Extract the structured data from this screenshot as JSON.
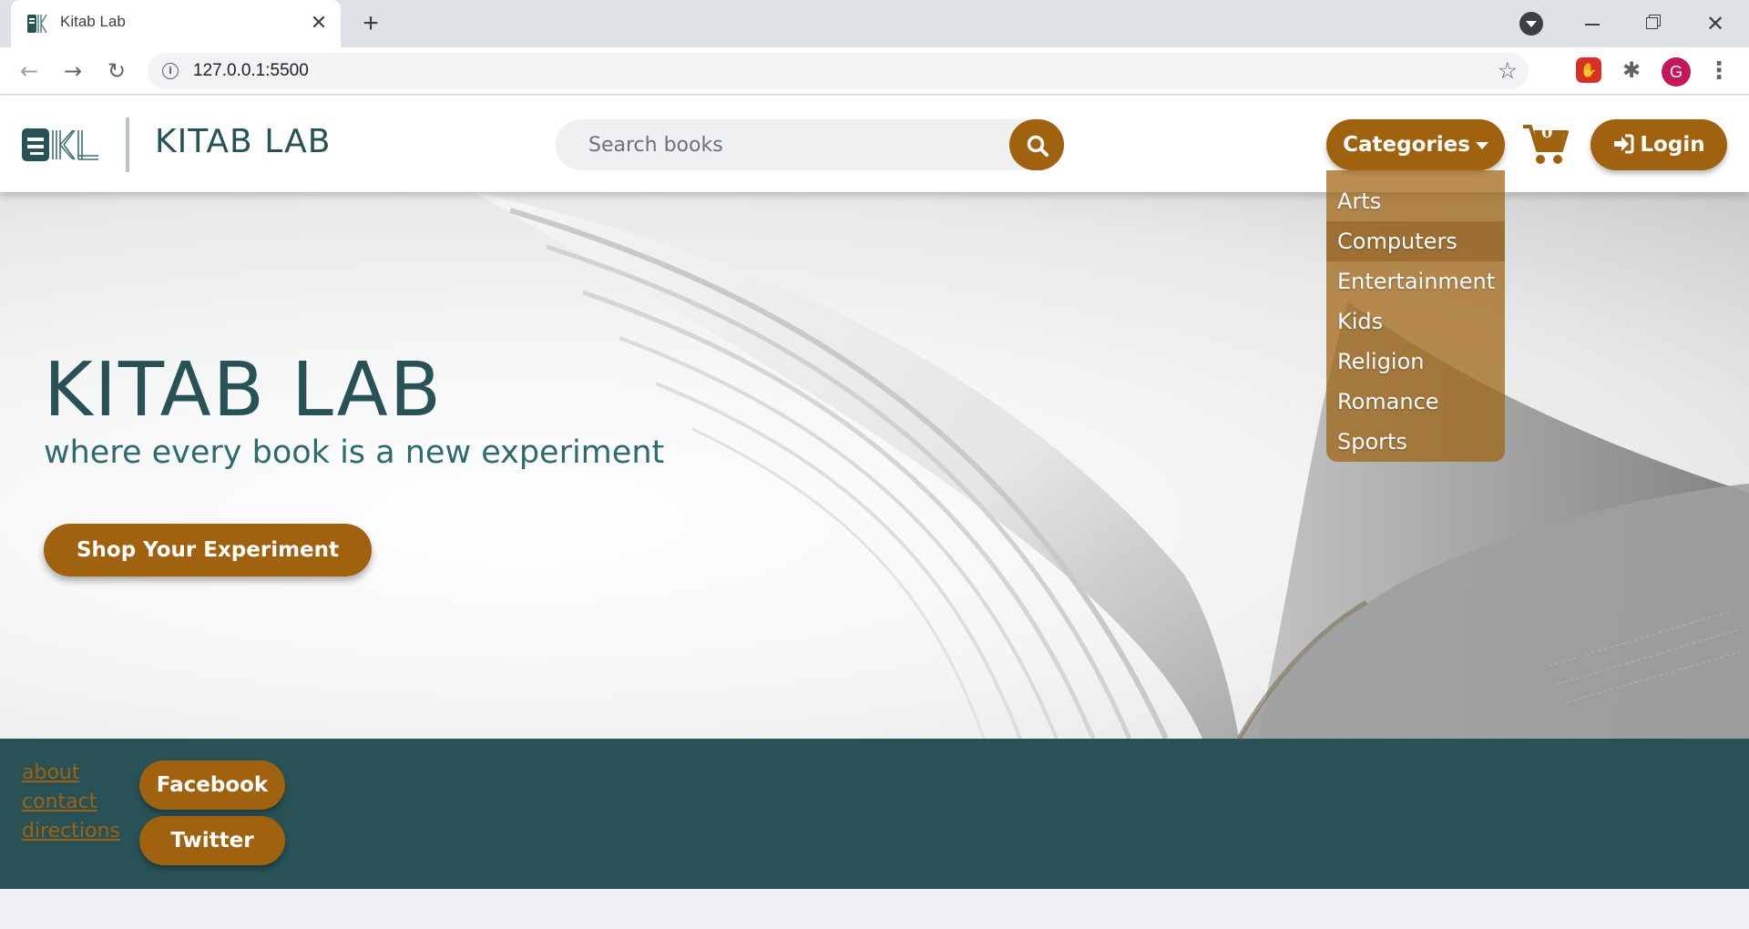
{
  "browser": {
    "tab_title": "Kitab Lab",
    "tab_close": "✕",
    "new_tab": "+",
    "url": "127.0.0.1:5500",
    "avatar_initial": "G",
    "icons": [
      "site-favicon",
      "close-icon",
      "plus-icon",
      "back-icon",
      "forward-icon",
      "reload-icon",
      "info-icon",
      "star-icon",
      "stop-extension-icon",
      "puzzle-icon",
      "kebab-icon"
    ]
  },
  "header": {
    "brand": "KITAB LAB",
    "search_placeholder": "Search books",
    "categories_label": "Categories",
    "cart_count": "0",
    "login_label": "Login"
  },
  "categories": {
    "items": [
      "Arts",
      "Computers",
      "Entertainment",
      "Kids",
      "Religion",
      "Romance",
      "Sports"
    ],
    "hovered": "Computers"
  },
  "hero": {
    "title": "KITAB LAB",
    "subtitle": "where every book is a new experiment",
    "cta_label": "Shop Your Experiment"
  },
  "footer": {
    "links": [
      "about",
      "contact",
      "directions"
    ],
    "social": [
      "Facebook",
      "Twitter"
    ]
  },
  "colors": {
    "brand_teal": "#285256",
    "accent_brown": "#a0620f",
    "page_bg": "#eef0f3"
  }
}
